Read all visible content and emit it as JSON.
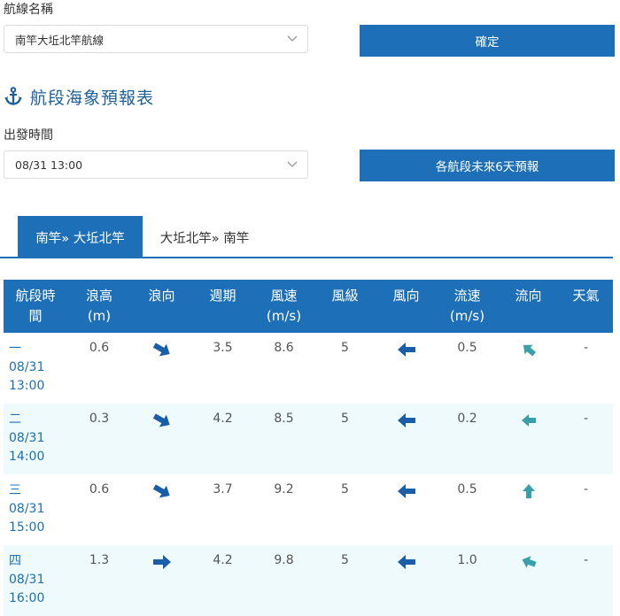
{
  "route": {
    "label": "航線名稱",
    "value": "南竿大坵北竿航線",
    "confirm_label": "確定"
  },
  "section": {
    "icon": "anchor-icon",
    "title": "航段海象預報表"
  },
  "departure": {
    "label": "出發時間",
    "value": "08/31 13:00",
    "forecast_label": "各航段未來6天預報"
  },
  "tabs": [
    {
      "label": "南竿» 大坵北竿",
      "active": true
    },
    {
      "label": "大坵北竿» 南竿",
      "active": false
    }
  ],
  "table": {
    "headers": [
      [
        "航段時",
        "間"
      ],
      [
        "浪高",
        "(m)"
      ],
      [
        "浪向",
        ""
      ],
      [
        "週期",
        ""
      ],
      [
        "風速",
        "(m/s)"
      ],
      [
        "風級",
        ""
      ],
      [
        "風向",
        ""
      ],
      [
        "流速",
        "(m/s)"
      ],
      [
        "流向",
        ""
      ],
      [
        "天氣",
        ""
      ]
    ],
    "rows": [
      {
        "seg": "一",
        "date": "08/31",
        "time": "13:00",
        "wave_height": "0.6",
        "wave_dir_icon": "wave-direction-arrow-icon",
        "period": "3.5",
        "wind_speed": "8.6",
        "wind_level": "5",
        "wind_dir_icon": "wind-direction-arrow-icon",
        "current_speed": "0.5",
        "current_dir_icon": "current-direction-arrow-icon",
        "weather": "-"
      },
      {
        "seg": "二",
        "date": "08/31",
        "time": "14:00",
        "wave_height": "0.3",
        "wave_dir_icon": "wave-direction-arrow-icon",
        "period": "4.2",
        "wind_speed": "8.5",
        "wind_level": "5",
        "wind_dir_icon": "wind-direction-arrow-icon",
        "current_speed": "0.2",
        "current_dir_icon": "current-direction-arrow-icon",
        "weather": "-"
      },
      {
        "seg": "三",
        "date": "08/31",
        "time": "15:00",
        "wave_height": "0.6",
        "wave_dir_icon": "wave-direction-arrow-icon",
        "period": "3.7",
        "wind_speed": "9.2",
        "wind_level": "5",
        "wind_dir_icon": "wind-direction-arrow-icon",
        "current_speed": "0.5",
        "current_dir_icon": "current-direction-arrow-icon",
        "weather": "-"
      },
      {
        "seg": "四",
        "date": "08/31",
        "time": "16:00",
        "wave_height": "1.3",
        "wave_dir_icon": "wave-direction-arrow-icon",
        "period": "4.2",
        "wind_speed": "9.8",
        "wind_level": "5",
        "wind_dir_icon": "wind-direction-arrow-icon",
        "current_speed": "1.0",
        "current_dir_icon": "current-direction-arrow-icon",
        "weather": "-"
      }
    ]
  },
  "colors": {
    "accent": "#1d6fb8",
    "title": "#1d5f99",
    "wind_arrow": "#1a5da8",
    "current_arrow": "#3aa0a8",
    "row_alt": "#eefafb"
  }
}
